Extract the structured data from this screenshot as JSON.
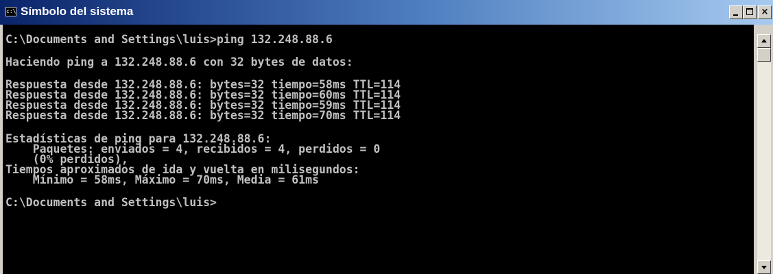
{
  "window": {
    "title": "Símbolo del sistema",
    "icon": "cmd-prompt-icon",
    "buttons": [
      "minimize",
      "maximize",
      "close"
    ],
    "close_glyph": "×"
  },
  "console": {
    "lines": [
      "C:\\Documents and Settings\\luis>ping 132.248.88.6",
      "",
      "Haciendo ping a 132.248.88.6 con 32 bytes de datos:",
      "",
      "Respuesta desde 132.248.88.6: bytes=32 tiempo=58ms TTL=114",
      "Respuesta desde 132.248.88.6: bytes=32 tiempo=60ms TTL=114",
      "Respuesta desde 132.248.88.6: bytes=32 tiempo=59ms TTL=114",
      "Respuesta desde 132.248.88.6: bytes=32 tiempo=70ms TTL=114",
      "",
      "Estadísticas de ping para 132.248.88.6:",
      "    Paquetes: enviados = 4, recibidos = 4, perdidos = 0",
      "    (0% perdidos),",
      "Tiempos aproximados de ida y vuelta en milisegundos:",
      "    Mínimo = 58ms, Máximo = 70ms, Media = 61ms",
      "",
      "C:\\Documents and Settings\\luis>"
    ]
  },
  "colors": {
    "title_bar_start": "#0a246a",
    "title_bar_end": "#a6caf0",
    "console_background": "#000000",
    "console_text": "#c0c0c0"
  }
}
